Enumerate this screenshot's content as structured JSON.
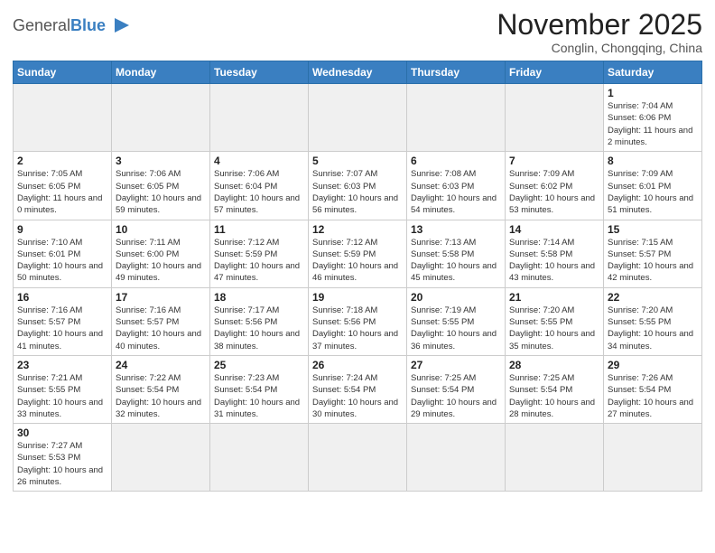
{
  "logo": {
    "text_general": "General",
    "text_blue": "Blue"
  },
  "title": "November 2025",
  "location": "Conglin, Chongqing, China",
  "days_of_week": [
    "Sunday",
    "Monday",
    "Tuesday",
    "Wednesday",
    "Thursday",
    "Friday",
    "Saturday"
  ],
  "weeks": [
    [
      {
        "day": "",
        "empty": true
      },
      {
        "day": "",
        "empty": true
      },
      {
        "day": "",
        "empty": true
      },
      {
        "day": "",
        "empty": true
      },
      {
        "day": "",
        "empty": true
      },
      {
        "day": "",
        "empty": true
      },
      {
        "day": "1",
        "info": "Sunrise: 7:04 AM\nSunset: 6:06 PM\nDaylight: 11 hours\nand 2 minutes."
      }
    ],
    [
      {
        "day": "2",
        "info": "Sunrise: 7:05 AM\nSunset: 6:05 PM\nDaylight: 11 hours\nand 0 minutes."
      },
      {
        "day": "3",
        "info": "Sunrise: 7:06 AM\nSunset: 6:05 PM\nDaylight: 10 hours\nand 59 minutes."
      },
      {
        "day": "4",
        "info": "Sunrise: 7:06 AM\nSunset: 6:04 PM\nDaylight: 10 hours\nand 57 minutes."
      },
      {
        "day": "5",
        "info": "Sunrise: 7:07 AM\nSunset: 6:03 PM\nDaylight: 10 hours\nand 56 minutes."
      },
      {
        "day": "6",
        "info": "Sunrise: 7:08 AM\nSunset: 6:03 PM\nDaylight: 10 hours\nand 54 minutes."
      },
      {
        "day": "7",
        "info": "Sunrise: 7:09 AM\nSunset: 6:02 PM\nDaylight: 10 hours\nand 53 minutes."
      },
      {
        "day": "8",
        "info": "Sunrise: 7:09 AM\nSunset: 6:01 PM\nDaylight: 10 hours\nand 51 minutes."
      }
    ],
    [
      {
        "day": "9",
        "info": "Sunrise: 7:10 AM\nSunset: 6:01 PM\nDaylight: 10 hours\nand 50 minutes."
      },
      {
        "day": "10",
        "info": "Sunrise: 7:11 AM\nSunset: 6:00 PM\nDaylight: 10 hours\nand 49 minutes."
      },
      {
        "day": "11",
        "info": "Sunrise: 7:12 AM\nSunset: 5:59 PM\nDaylight: 10 hours\nand 47 minutes."
      },
      {
        "day": "12",
        "info": "Sunrise: 7:12 AM\nSunset: 5:59 PM\nDaylight: 10 hours\nand 46 minutes."
      },
      {
        "day": "13",
        "info": "Sunrise: 7:13 AM\nSunset: 5:58 PM\nDaylight: 10 hours\nand 45 minutes."
      },
      {
        "day": "14",
        "info": "Sunrise: 7:14 AM\nSunset: 5:58 PM\nDaylight: 10 hours\nand 43 minutes."
      },
      {
        "day": "15",
        "info": "Sunrise: 7:15 AM\nSunset: 5:57 PM\nDaylight: 10 hours\nand 42 minutes."
      }
    ],
    [
      {
        "day": "16",
        "info": "Sunrise: 7:16 AM\nSunset: 5:57 PM\nDaylight: 10 hours\nand 41 minutes."
      },
      {
        "day": "17",
        "info": "Sunrise: 7:16 AM\nSunset: 5:57 PM\nDaylight: 10 hours\nand 40 minutes."
      },
      {
        "day": "18",
        "info": "Sunrise: 7:17 AM\nSunset: 5:56 PM\nDaylight: 10 hours\nand 38 minutes."
      },
      {
        "day": "19",
        "info": "Sunrise: 7:18 AM\nSunset: 5:56 PM\nDaylight: 10 hours\nand 37 minutes."
      },
      {
        "day": "20",
        "info": "Sunrise: 7:19 AM\nSunset: 5:55 PM\nDaylight: 10 hours\nand 36 minutes."
      },
      {
        "day": "21",
        "info": "Sunrise: 7:20 AM\nSunset: 5:55 PM\nDaylight: 10 hours\nand 35 minutes."
      },
      {
        "day": "22",
        "info": "Sunrise: 7:20 AM\nSunset: 5:55 PM\nDaylight: 10 hours\nand 34 minutes."
      }
    ],
    [
      {
        "day": "23",
        "info": "Sunrise: 7:21 AM\nSunset: 5:55 PM\nDaylight: 10 hours\nand 33 minutes."
      },
      {
        "day": "24",
        "info": "Sunrise: 7:22 AM\nSunset: 5:54 PM\nDaylight: 10 hours\nand 32 minutes."
      },
      {
        "day": "25",
        "info": "Sunrise: 7:23 AM\nSunset: 5:54 PM\nDaylight: 10 hours\nand 31 minutes."
      },
      {
        "day": "26",
        "info": "Sunrise: 7:24 AM\nSunset: 5:54 PM\nDaylight: 10 hours\nand 30 minutes."
      },
      {
        "day": "27",
        "info": "Sunrise: 7:25 AM\nSunset: 5:54 PM\nDaylight: 10 hours\nand 29 minutes."
      },
      {
        "day": "28",
        "info": "Sunrise: 7:25 AM\nSunset: 5:54 PM\nDaylight: 10 hours\nand 28 minutes."
      },
      {
        "day": "29",
        "info": "Sunrise: 7:26 AM\nSunset: 5:54 PM\nDaylight: 10 hours\nand 27 minutes."
      }
    ],
    [
      {
        "day": "30",
        "info": "Sunrise: 7:27 AM\nSunset: 5:53 PM\nDaylight: 10 hours\nand 26 minutes."
      },
      {
        "day": "",
        "empty": true
      },
      {
        "day": "",
        "empty": true
      },
      {
        "day": "",
        "empty": true
      },
      {
        "day": "",
        "empty": true
      },
      {
        "day": "",
        "empty": true
      },
      {
        "day": "",
        "empty": true
      }
    ]
  ]
}
